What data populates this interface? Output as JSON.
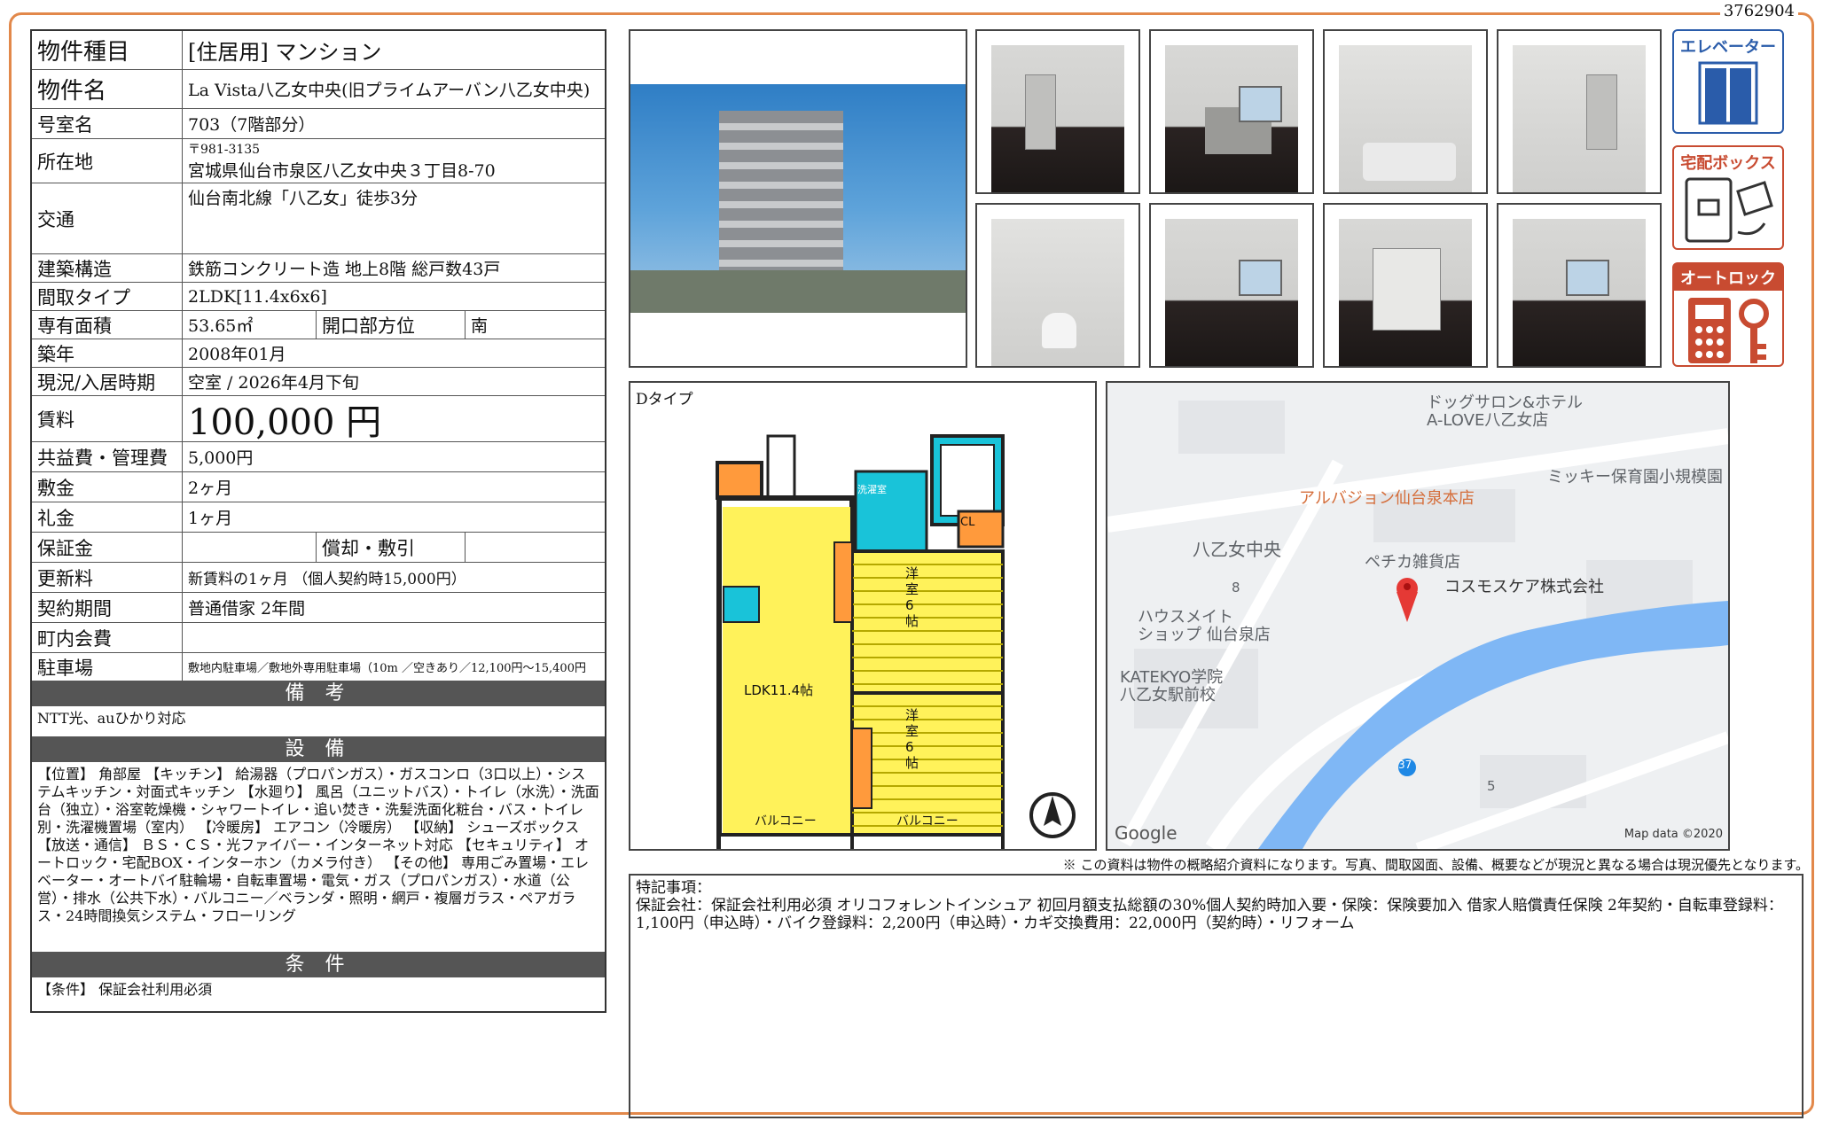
{
  "doc_no": "3762904",
  "property": {
    "type_label": "物件種目",
    "type_value": "[住居用] マンション",
    "name_label": "物件名",
    "name_value": "La Vista八乙女中央(旧プライムアーバン八乙女中央)",
    "room_label": "号室名",
    "room_value": "703（7階部分）",
    "addr_label": "所在地",
    "zip": "〒981-3135",
    "addr_value": "宮城県仙台市泉区八乙女中央３丁目8-70",
    "access_label": "交通",
    "access_value": "仙台南北線「八乙女」徒歩3分",
    "structure_label": "建築構造",
    "structure_value": "鉄筋コンクリート造 地上8階 総戸数43戸",
    "layout_label": "間取タイプ",
    "layout_value": "2LDK[11.4x6x6]",
    "area_label": "専有面積",
    "area_value": "53.65㎡",
    "opening_label": "開口部方位",
    "opening_value": "南",
    "built_label": "築年",
    "built_value": "2008年01月",
    "status_label": "現況/入居時期",
    "status_value": "空室 / 2026年4月下旬",
    "rent_label": "賃料",
    "rent_value": "100,000 円",
    "fee_label": "共益費・管理費",
    "fee_value": "5,000円",
    "deposit_label": "敷金",
    "deposit_value": "2ヶ月",
    "key_label": "礼金",
    "key_value": "1ヶ月",
    "guarantee_label": "保証金",
    "guarantee_value": "",
    "amort_label": "償却・敷引",
    "amort_value": "",
    "renewal_label": "更新料",
    "renewal_value": "新賃料の1ヶ月 （個人契約時15,000円）",
    "contract_label": "契約期間",
    "contract_value": "普通借家 2年間",
    "town_label": "町内会費",
    "town_value": "",
    "parking_label": "駐車場",
    "parking_value": "敷地内駐車場／敷地外専用駐車場（10m ／空きあり／12,100円～15,400円"
  },
  "sections": {
    "remarks_title": "備 考",
    "remarks_text": "NTT光、auひかり対応",
    "equip_title": "設 備",
    "equip_text": "【位置】 角部屋 【キッチン】 給湯器（プロパンガス）・ガスコンロ（3口以上）・システムキッチン・対面式キッチン 【水廻り】 風呂（ユニットバス）・トイレ（水洗）・洗面台（独立）・浴室乾燥機・シャワートイレ・追い焚き・洗髪洗面化粧台・バス・トイレ別・洗濯機置場（室内） 【冷暖房】 エアコン（冷暖房） 【収納】 シューズボックス 【放送・通信】 ＢＳ・ＣＳ・光ファイバー・インターネット対応 【セキュリティ】 オートロック・宅配BOX・インターホン（カメラ付き） 【その他】 専用ごみ置場・エレベーター・オートバイ駐輪場・自転車置場・電気・ガス（プロパンガス）・水道（公営）・排水（公共下水）・バルコニー／ベランダ・照明・網戸・複層ガラス・ペアガラス・24時間換気システム・フローリング",
    "cond_title": "条 件",
    "cond_text": "【条件】 保証会社利用必須"
  },
  "icons": {
    "elevator": "エレベーター",
    "delivery": "宅配ボックス",
    "autolock": "オートロック"
  },
  "floorplan": {
    "type": "Dタイプ",
    "ldk": "LDK11.4帖",
    "room1": "洋室6帖",
    "room2": "洋室6帖",
    "balcony1": "バルコニー",
    "balcony2": "バルコニー",
    "cl": "CL",
    "wash": "洗濯室"
  },
  "map": {
    "p1": "ドッグサロン&ホテル",
    "p1b": "A-LOVE八乙女店",
    "p2": "ミッキー保育園小規模園",
    "p3": "アルバジョン仙台泉本店",
    "p4": "八乙女中央",
    "p5": "ペチカ雑貨店",
    "p6": "コスモスケア株式会社",
    "p7": "ハウスメイト",
    "p7b": "ショップ 仙台泉店",
    "p8": "KATEKYO学院",
    "p8b": "八乙女駅前校",
    "n8": "8",
    "n5": "5",
    "route": "37",
    "google": "Google",
    "mapdata": "Map data ©2020"
  },
  "disclaimer": "※ この資料は物件の概略紹介資料になります。写真、間取図面、設備、概要などが現況と異なる場合は現況優先となります。",
  "special": {
    "title": "特記事項：",
    "text": "保証会社：保証会社利用必須 オリコフォレントインシュア 初回月額支払総額の30%個人契約時加入要・保険：保険要加入 借家人賠償責任保険 2年契約・自転車登録料：1,100円（申込時）・バイク登録料：2,200円（申込時）・カギ交換費用：22,000円（契約時）・リフォーム"
  }
}
